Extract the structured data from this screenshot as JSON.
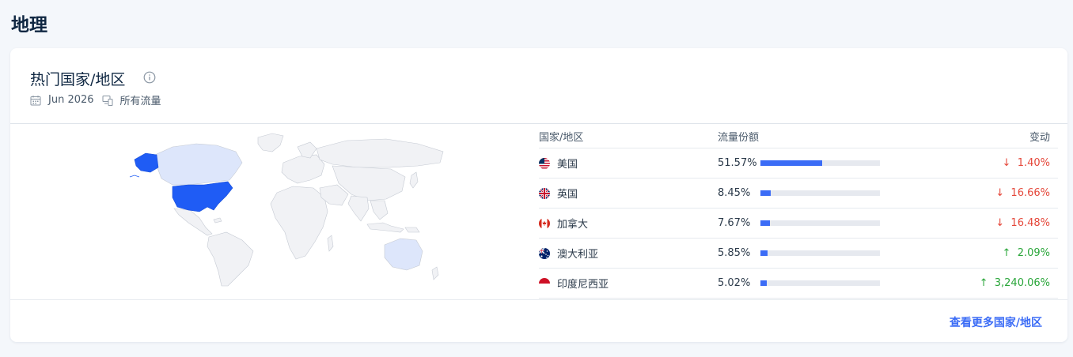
{
  "page_title": "地理",
  "card": {
    "title": "热门国家/地区",
    "date": "Jun 2026",
    "traffic": "所有流量",
    "more_link": "查看更多国家/地区"
  },
  "table": {
    "headers": {
      "country": "国家/地区",
      "share": "流量份额",
      "change": "变动"
    },
    "rows": [
      {
        "flag": "us-flag-icon",
        "country": "美国",
        "share": "51.57%",
        "share_value": 0.5157,
        "change": "1.40%",
        "direction": "down"
      },
      {
        "flag": "uk-flag-icon",
        "country": "英国",
        "share": "8.45%",
        "share_value": 0.0845,
        "change": "16.66%",
        "direction": "down"
      },
      {
        "flag": "ca-flag-icon",
        "country": "加拿大",
        "share": "7.67%",
        "share_value": 0.0767,
        "change": "16.48%",
        "direction": "down"
      },
      {
        "flag": "au-flag-icon",
        "country": "澳大利亚",
        "share": "5.85%",
        "share_value": 0.0585,
        "change": "2.09%",
        "direction": "up"
      },
      {
        "flag": "id-flag-icon",
        "country": "印度尼西亚",
        "share": "5.02%",
        "share_value": 0.0502,
        "change": "3,240.06%",
        "direction": "up"
      }
    ]
  },
  "colors": {
    "accent": "#3b6cf6",
    "usa_fill": "#1f5cf5",
    "highlight_fill": "#dde6fb",
    "down": "#e5483b",
    "up": "#2aa63a"
  }
}
